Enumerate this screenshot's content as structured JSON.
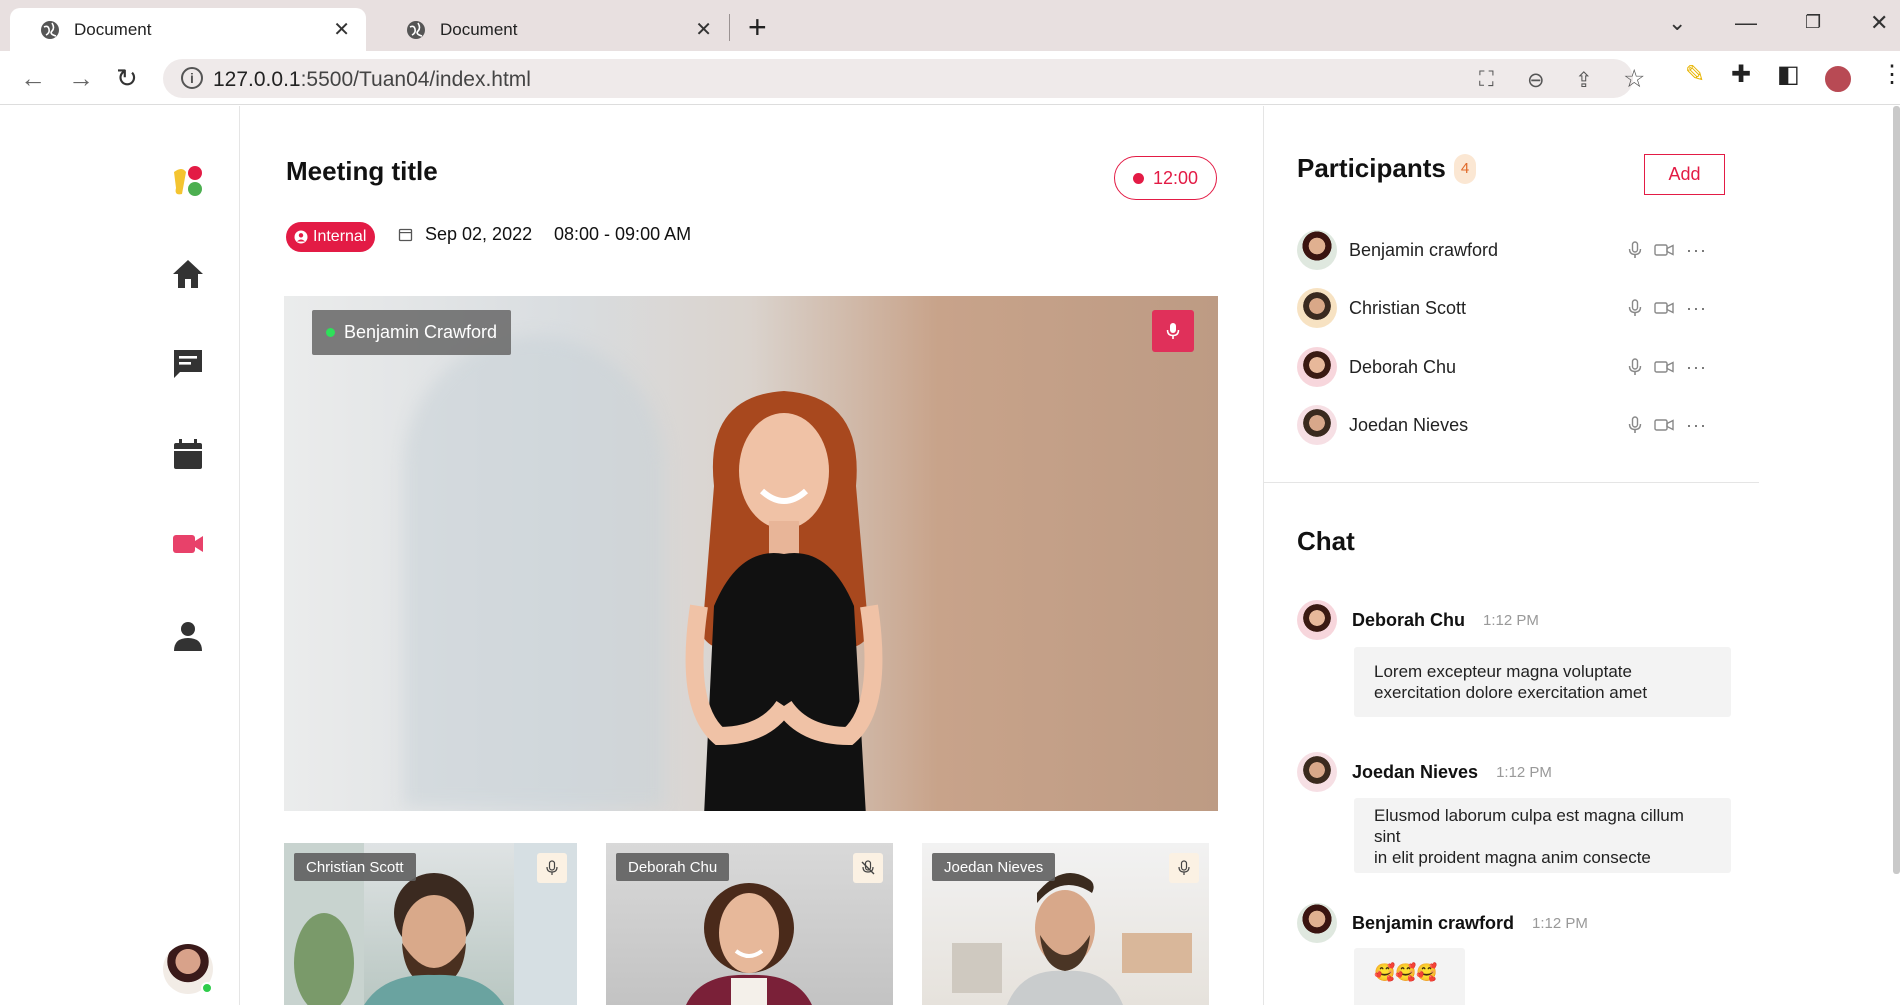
{
  "browser": {
    "tabs": [
      {
        "title": "Document",
        "active": true
      },
      {
        "title": "Document",
        "active": false
      }
    ],
    "url_host": "127.0.0.1",
    "url_path": ":5500/Tuan04/index.html"
  },
  "sidebar": {
    "nav": [
      {
        "icon": "home-icon",
        "active": false
      },
      {
        "icon": "chat-icon",
        "active": false
      },
      {
        "icon": "calendar-icon",
        "active": false
      },
      {
        "icon": "video-camera-icon",
        "active": true
      },
      {
        "icon": "user-icon",
        "active": false
      }
    ],
    "accent": "#e31b45"
  },
  "meeting": {
    "title": "Meeting title",
    "timer": "12:00",
    "badge": "Internal",
    "date": "Sep 02, 2022",
    "time": "08:00 - 09:00 AM",
    "main_speaker": "Benjamin Crawford",
    "thumbnails": [
      {
        "name": "Christian Scott",
        "muted": false
      },
      {
        "name": "Deborah Chu",
        "muted": true
      },
      {
        "name": "Joedan Nieves",
        "muted": false
      }
    ]
  },
  "participants": {
    "title": "Participants",
    "count": "4",
    "add_label": "Add",
    "list": [
      {
        "name": "Benjamin crawford"
      },
      {
        "name": "Christian Scott"
      },
      {
        "name": "Deborah Chu"
      },
      {
        "name": "Joedan Nieves"
      }
    ]
  },
  "chat": {
    "title": "Chat",
    "messages": [
      {
        "sender": "Deborah Chu",
        "time": "1:12 PM",
        "text": "Lorem excepteur magna voluptate exercitation dolore exercitation amet"
      },
      {
        "sender": "Joedan Nieves",
        "time": "1:12 PM",
        "text_line1": "Elusmod laborum culpa est magna cillum sint",
        "text_line2": "in elit proident magna anim consecte"
      },
      {
        "sender": "Benjamin crawford",
        "time": "1:12 PM",
        "text": "🥰🥰🥰"
      }
    ]
  }
}
